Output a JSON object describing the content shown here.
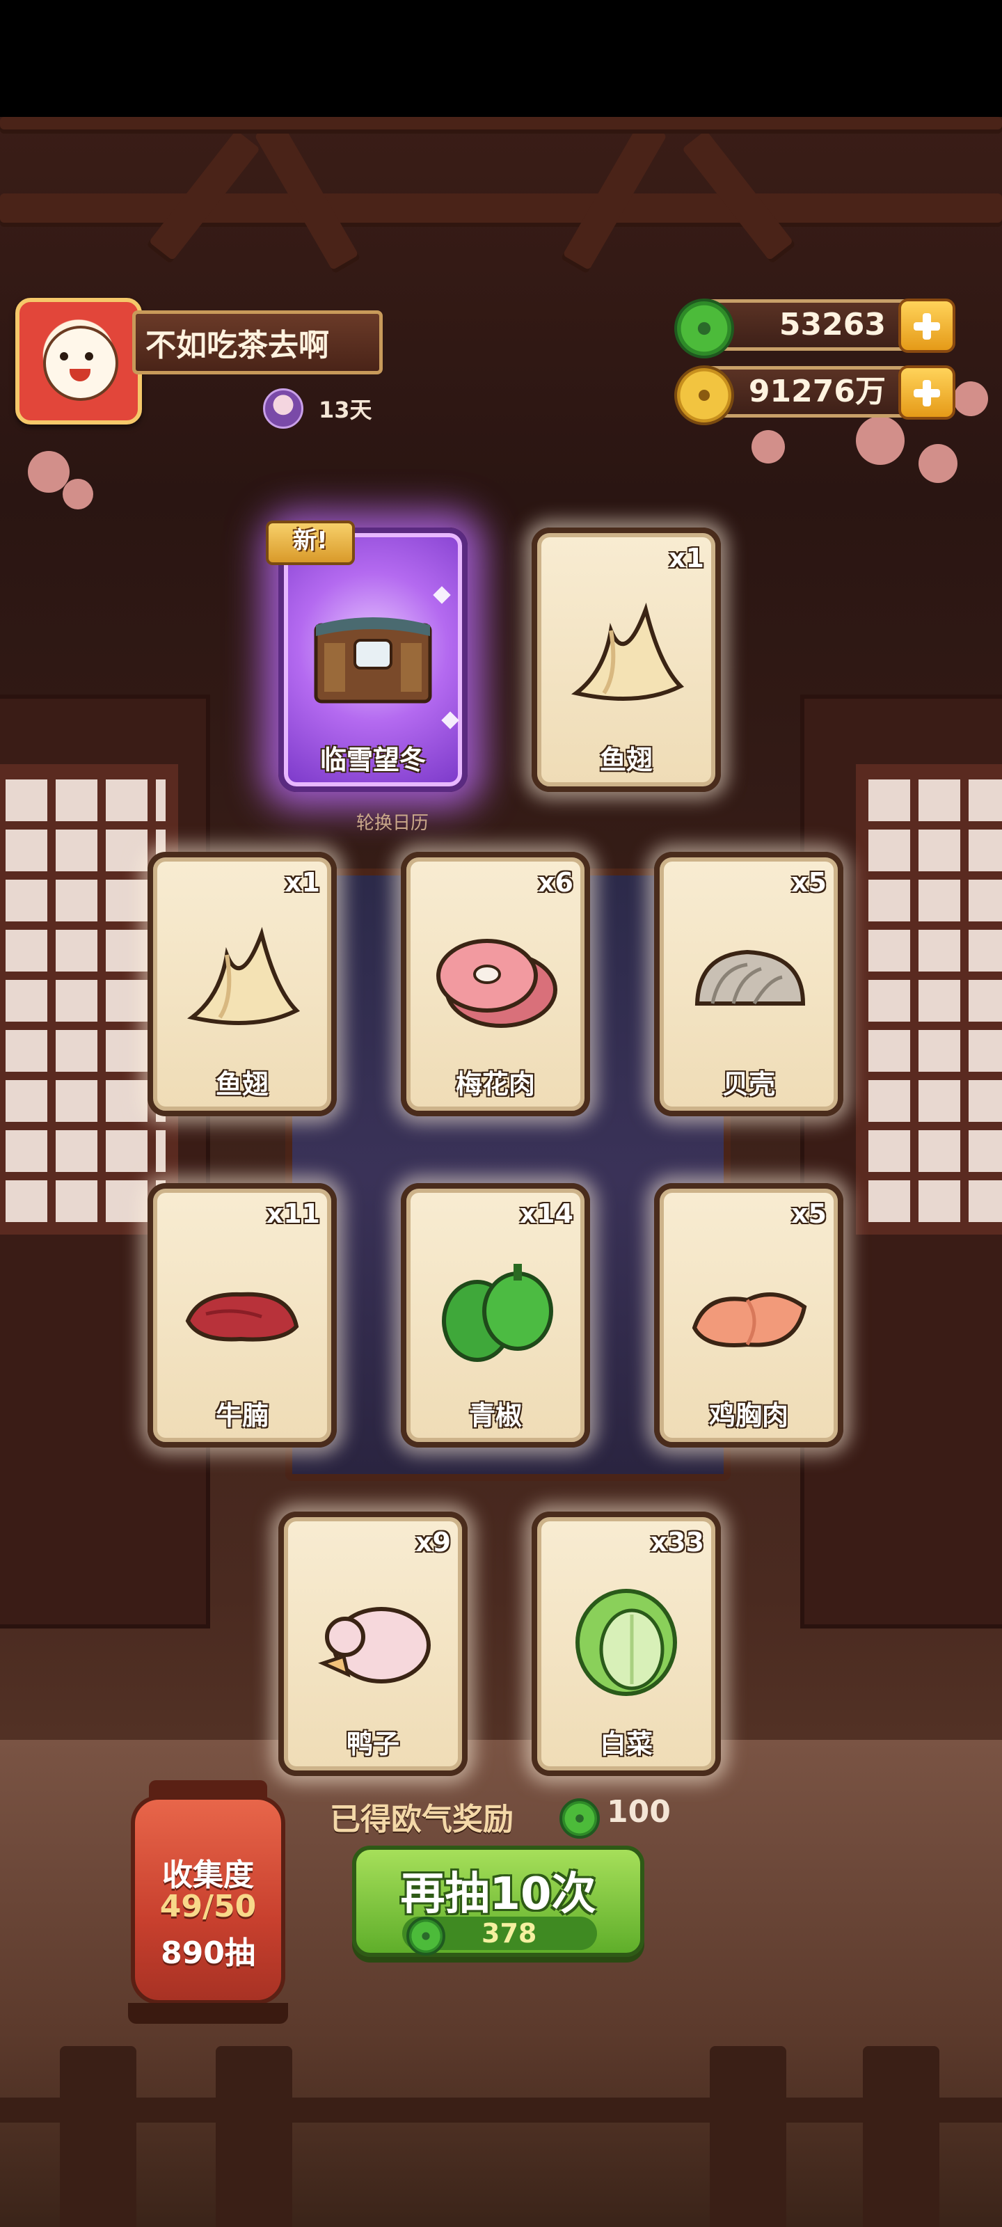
{
  "player": {
    "name": "不如吃茶去啊",
    "streak": "13天"
  },
  "currency": {
    "jade": "53263",
    "coins": "91276万"
  },
  "cards": [
    {
      "label": "临雪望冬",
      "qty": "",
      "tag": "新!",
      "kind": "scene"
    },
    {
      "label": "鱼翅",
      "qty": "x1",
      "kind": "fin"
    },
    {
      "label": "鱼翅",
      "qty": "x1",
      "kind": "fin"
    },
    {
      "label": "梅花肉",
      "qty": "x6",
      "kind": "pork"
    },
    {
      "label": "贝壳",
      "qty": "x5",
      "kind": "shell"
    },
    {
      "label": "牛腩",
      "qty": "x11",
      "kind": "beef"
    },
    {
      "label": "青椒",
      "qty": "x14",
      "kind": "pepper"
    },
    {
      "label": "鸡胸肉",
      "qty": "x5",
      "kind": "chicken"
    },
    {
      "label": "鸭子",
      "qty": "x9",
      "kind": "duck"
    },
    {
      "label": "白菜",
      "qty": "x33",
      "kind": "cabbage"
    }
  ],
  "background_caption": "轮换日历",
  "reward": {
    "label": "已得欧气奖励",
    "value": "100"
  },
  "draw_button": {
    "label": "再抽10次",
    "cost": "378"
  },
  "collection": {
    "title": "收集度",
    "progress": "49/50",
    "draws": "890抽"
  },
  "colors": {
    "jade": "#4cbb3a",
    "coin": "#f2c440",
    "special_glow": "#b46af0",
    "button_green": "#6fbf34"
  }
}
